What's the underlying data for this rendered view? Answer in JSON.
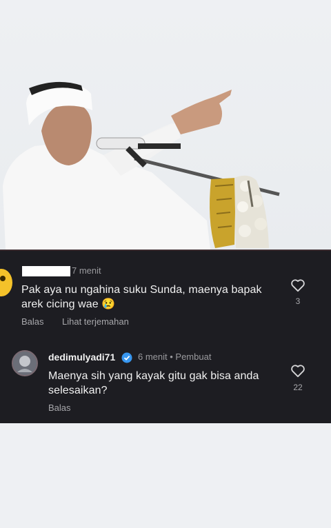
{
  "comment_1": {
    "time": "7 menit",
    "text": "Pak aya nu ngahina suku Sunda, maenya bapak arek cicing wae 😢",
    "reply_label": "Balas",
    "translate_label": "Lihat terjemahan",
    "like_count": "3"
  },
  "comment_2": {
    "username": "dedimulyadi71",
    "time": "6 menit • Pembuat",
    "text": "Maenya sih yang kayak gitu gak bisa anda selesaikan?",
    "reply_label": "Balas",
    "like_count": "22"
  },
  "colors": {
    "panel_bg": "#1d1d22",
    "verified_blue": "#3897f0",
    "text": "#f1f1f1",
    "muted": "#a8a8ac"
  },
  "icons": {
    "like": "heart-outline-icon",
    "verified": "verified-badge-icon"
  }
}
